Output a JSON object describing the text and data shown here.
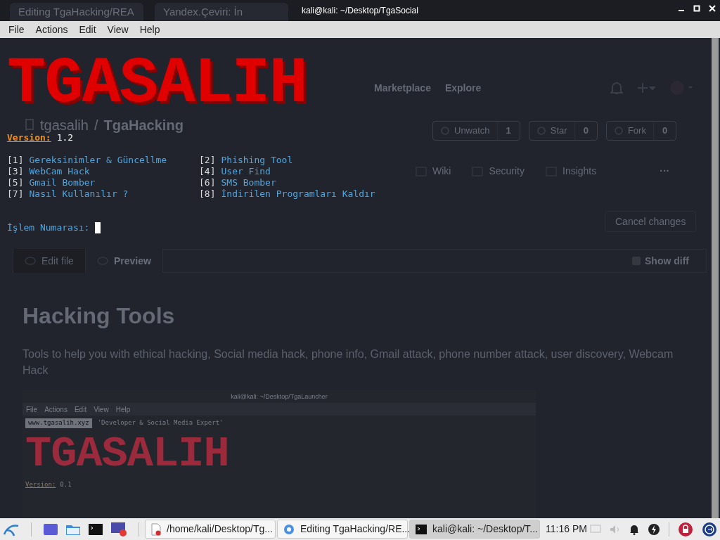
{
  "background_browser": {
    "tabs": [
      "Editing TgaHacking/REA",
      "Yandex.Çeviri: İn"
    ],
    "nav": [
      "Marketplace",
      "Explore"
    ],
    "repo": {
      "owner": "tgasalih",
      "separator": "/",
      "name": "TgaHacking"
    },
    "repo_buttons": [
      {
        "label": "Unwatch",
        "count": "1"
      },
      {
        "label": "Star",
        "count": "0"
      },
      {
        "label": "Fork",
        "count": "0"
      }
    ],
    "repo_tabs": [
      "Wiki",
      "Security",
      "Insights"
    ],
    "repo_more": "···",
    "cancel_button": "Cancel changes",
    "editor_tabs": [
      {
        "label": "Edit file",
        "selected": false
      },
      {
        "label": "Preview",
        "selected": true
      }
    ],
    "show_diff": {
      "label": "Show diff",
      "checked": false
    },
    "heading": "Hacking Tools",
    "description": "Tools to help you with ethical hacking, Social media hack, phone info, Gmail attack, phone number attack, user discovery, Webcam Hack",
    "screenshot": {
      "title": "kali@kali: ~/Desktop/TgaLauncher",
      "menu": [
        "File",
        "Actions",
        "Edit",
        "View",
        "Help"
      ],
      "url": "www.tgasalih.xyz",
      "tagline": "'Developer & Social Media Expert'",
      "banner": "TGASALIH",
      "version_label": "Version:",
      "version": "0.1"
    }
  },
  "terminal": {
    "title": "kali@kali: ~/Desktop/TgaSocial",
    "menu": [
      "File",
      "Actions",
      "Edit",
      "View",
      "Help"
    ],
    "banner": "TGASALIH",
    "version_label": "Version:",
    "version": "1.2",
    "options": [
      {
        "number": "[1]",
        "label": "Gereksinimler & Güncellme"
      },
      {
        "number": "[2]",
        "label": "Phishing Tool"
      },
      {
        "number": "[3]",
        "label": "WebCam Hack"
      },
      {
        "number": "[4]",
        "label": "User Find"
      },
      {
        "number": "[5]",
        "label": "Gmail Bomber"
      },
      {
        "number": "[6]",
        "label": "SMS Bomber"
      },
      {
        "number": "[7]",
        "label": "Nasıl Kullanılır ?"
      },
      {
        "number": "[8]",
        "label": "İndirilen Programları Kaldır"
      }
    ],
    "prompt": "İşlem Numarası:"
  },
  "taskbar": {
    "tasks": [
      {
        "kind": "file",
        "label": "/home/kali/Desktop/Tg...",
        "selected": false
      },
      {
        "kind": "browser",
        "label": "Editing TgaHacking/RE...",
        "selected": false
      },
      {
        "kind": "terminal",
        "label": "kali@kali: ~/Desktop/T...",
        "selected": true
      }
    ],
    "clock": "11:16 PM"
  }
}
